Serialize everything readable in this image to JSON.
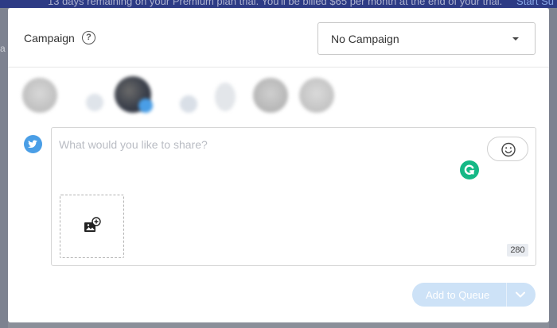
{
  "background": {
    "banner_text": "13 days remaining on your Premium plan trial. You'll be billed $65 per month at the end of your trial.",
    "banner_link": "Start Su",
    "page_fragment": "a"
  },
  "header": {
    "campaign_label": "Campaign",
    "help_icon": "?",
    "campaign_select": {
      "value": "No Campaign"
    }
  },
  "accounts": [
    {
      "name": "profile-1",
      "selected": false
    },
    {
      "name": "profile-2",
      "selected": false
    },
    {
      "name": "profile-3",
      "selected": true
    },
    {
      "name": "profile-4",
      "selected": false
    },
    {
      "name": "profile-5",
      "selected": false
    },
    {
      "name": "profile-6",
      "selected": false
    },
    {
      "name": "profile-7",
      "selected": false
    }
  ],
  "composer": {
    "network_icon": "twitter-icon",
    "placeholder": "What would you like to share?",
    "char_count": "280"
  },
  "footer": {
    "add_to_queue_label": "Add to Queue"
  },
  "colors": {
    "accent": "#4a9ee6",
    "button_disabled": "#cde2f7",
    "grammarly": "#15b886"
  }
}
